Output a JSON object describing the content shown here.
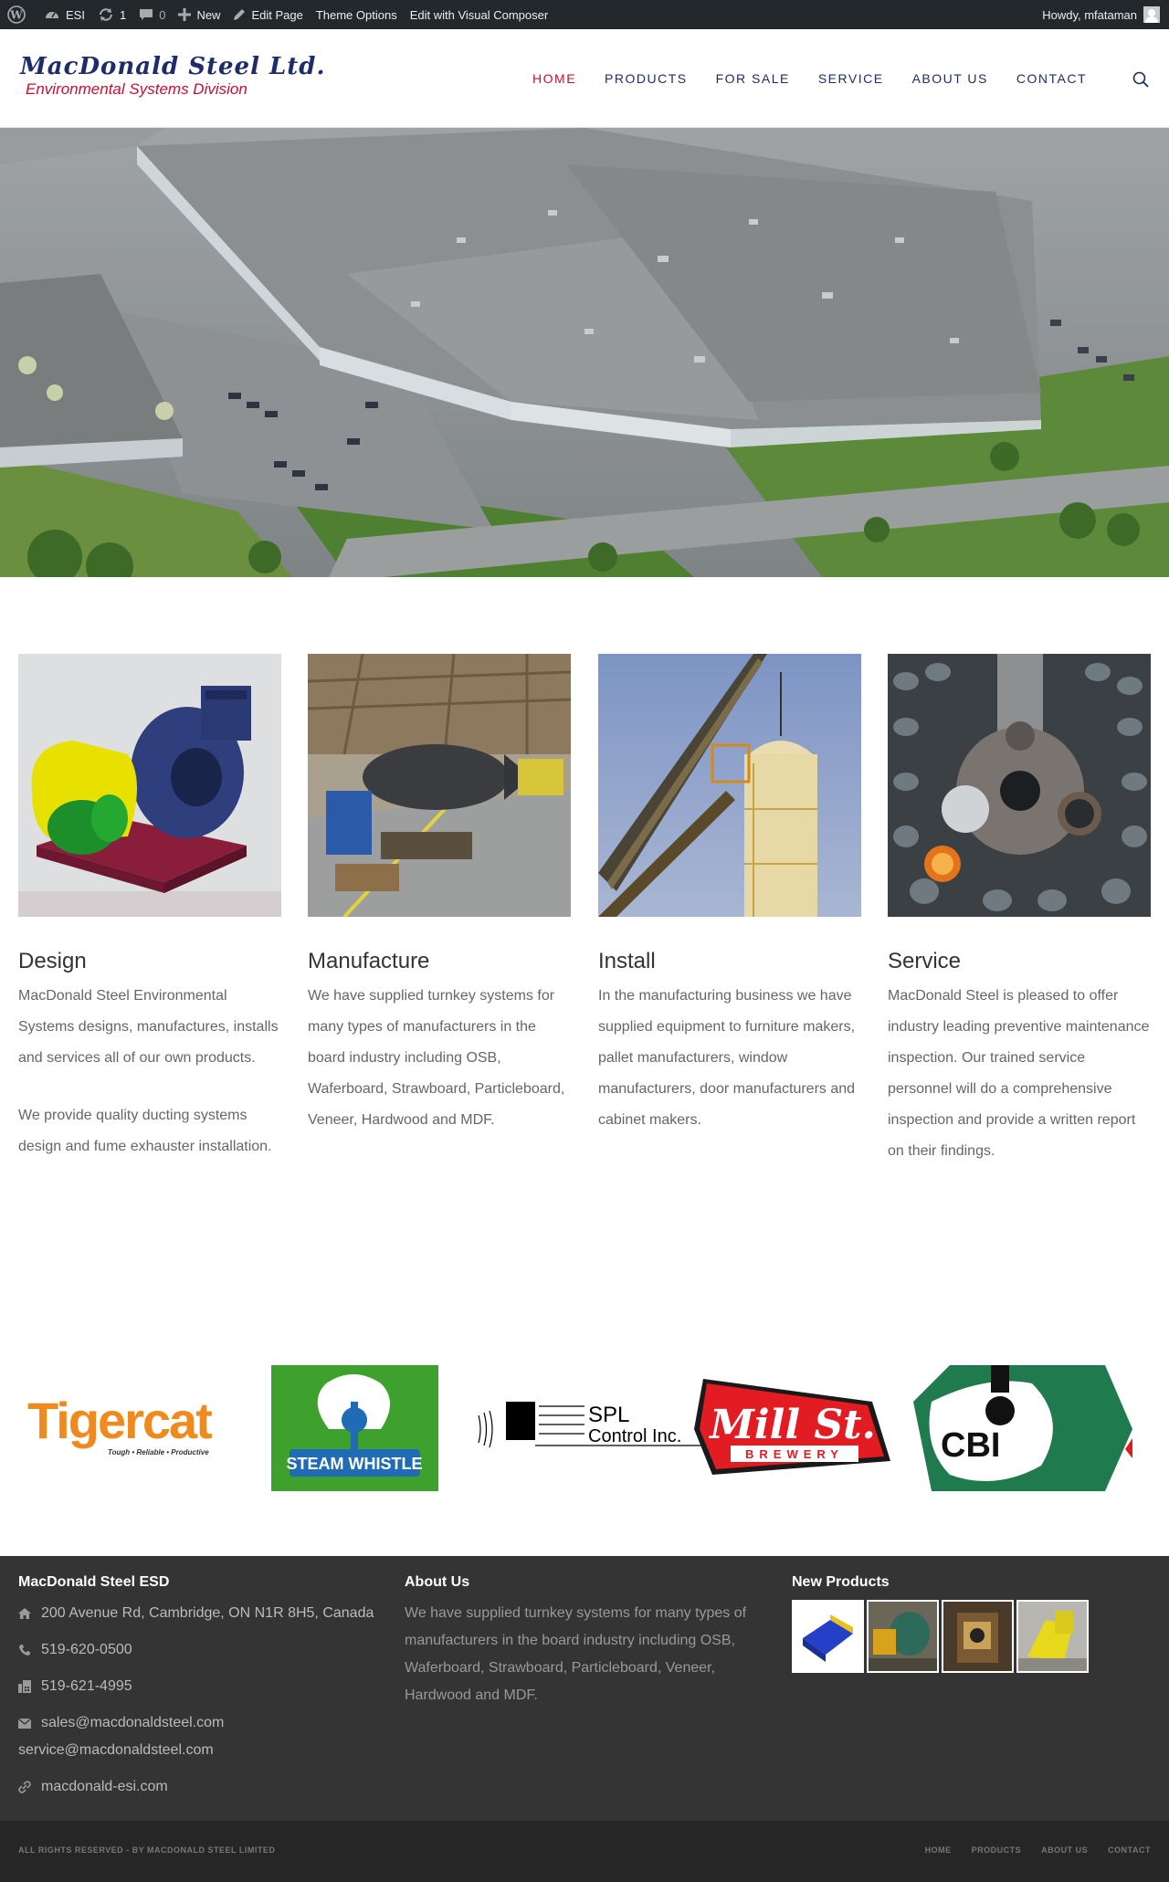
{
  "adminbar": {
    "site": "ESI",
    "updates": "1",
    "comments": "0",
    "new_label": "New",
    "edit_page": "Edit Page",
    "theme_options": "Theme Options",
    "visual_composer": "Edit with Visual Composer",
    "howdy": "Howdy, mfataman"
  },
  "header": {
    "logo_main": "MacDonald Steel Ltd.",
    "logo_sub": "Environmental Systems Division",
    "nav": [
      "HOME",
      "PRODUCTS",
      "FOR SALE",
      "SERVICE",
      "ABOUT US",
      "CONTACT"
    ]
  },
  "features": [
    {
      "title": "Design",
      "paragraphs": [
        "MacDonald Steel Environmental Systems designs, manufactures, installs and services all of our own products.",
        "We provide quality ducting systems design and fume exhauster installation."
      ]
    },
    {
      "title": "Manufacture",
      "paragraphs": [
        "We have supplied turnkey systems for many types of manufacturers in the board industry including OSB, Waferboard, Strawboard, Particleboard, Veneer, Hardwood and MDF."
      ]
    },
    {
      "title": "Install",
      "paragraphs": [
        "In the manufacturing business we have supplied equipment to furniture makers, pallet manufacturers, window manufacturers, door manufacturers and cabinet makers."
      ]
    },
    {
      "title": "Service",
      "paragraphs": [
        "MacDonald Steel is pleased to offer industry leading preventive maintenance inspection. Our trained service personnel will do a comprehensive inspection and provide a written report on their findings."
      ]
    }
  ],
  "clients": {
    "tigercat": "Tigercat",
    "tigercat_tag": "Tough • Reliable • Productive",
    "steamwhistle": "STEAM WHISTLE",
    "spl_1": "SPL",
    "spl_2": "Control Inc.",
    "millst": "Mill St.",
    "brewery": "BREWERY",
    "cbi": "CBI"
  },
  "footer": {
    "col1_title": "MacDonald Steel ESD",
    "address": "200 Avenue Rd, Cambridge, ON N1R 8H5, Canada",
    "phone": "519-620-0500",
    "fax": "519-621-4995",
    "email1": "sales@macdonaldsteel.com",
    "email2": "service@macdonaldsteel.com",
    "website": "macdonald-esi.com",
    "col2_title": "About Us",
    "about_text": "We have supplied turnkey systems for many types of manufacturers in the board industry including OSB, Waferboard, Strawboard, Particleboard, Veneer, Hardwood and MDF.",
    "col3_title": "New Products",
    "copyright": "ALL RIGHTS RESERVED - BY MACDONALD STEEL LIMITED",
    "nav": [
      "HOME",
      "PRODUCTS",
      "ABOUT US",
      "CONTACT"
    ]
  },
  "colors": {
    "brand_navy": "#1e2c6b",
    "brand_red": "#c8102e",
    "adminbar": "#23282d",
    "footer": "#343434"
  }
}
